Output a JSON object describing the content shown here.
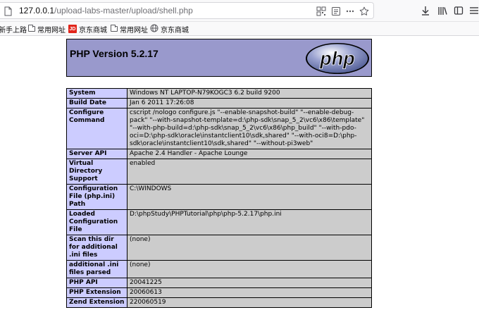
{
  "browser": {
    "url_host": "127.0.0.1",
    "url_path": "/upload-labs-master/upload/shell.php"
  },
  "bookmarks": [
    {
      "label": "新手上路",
      "icon": "none"
    },
    {
      "label": "常用网址",
      "icon": "folder-icon"
    },
    {
      "label": "京东商城",
      "icon": "jd-logo-icon"
    },
    {
      "label": "常用网址",
      "icon": "folder-icon"
    },
    {
      "label": "京东商城",
      "icon": "globe-icon"
    }
  ],
  "page": {
    "title": "PHP Version 5.2.17",
    "logo_text": "php",
    "rows": [
      {
        "key": "System",
        "value": "Windows NT LAPTOP-N79KOGC3 6.2 build 9200"
      },
      {
        "key": "Build Date",
        "value": "Jan 6 2011 17:26:08"
      },
      {
        "key": "Configure Command",
        "value": "cscript /nologo configure.js \"--enable-snapshot-build\" \"--enable-debug-pack\" \"--with-snapshot-template=d:\\php-sdk\\snap_5_2\\vc6\\x86\\template\" \"--with-php-build=d:\\php-sdk\\snap_5_2\\vc6\\x86\\php_build\" \"--with-pdo-oci=D:\\php-sdk\\oracle\\instantclient10\\sdk,shared\" \"--with-oci8=D:\\php-sdk\\oracle\\instantclient10\\sdk,shared\" \"--without-pi3web\""
      },
      {
        "key": "Server API",
        "value": "Apache 2.4 Handler - Apache Lounge"
      },
      {
        "key": "Virtual Directory Support",
        "value": "enabled"
      },
      {
        "key": "Configuration File (php.ini) Path",
        "value": "C:\\WINDOWS"
      },
      {
        "key": "Loaded Configuration File",
        "value": "D:\\phpStudy\\PHPTutorial\\php\\php-5.2.17\\php.ini"
      },
      {
        "key": "Scan this dir for additional .ini files",
        "value": "(none)"
      },
      {
        "key": "additional .ini files parsed",
        "value": "(none)"
      },
      {
        "key": "PHP API",
        "value": "20041225"
      },
      {
        "key": "PHP Extension",
        "value": "20060613"
      },
      {
        "key": "Zend Extension",
        "value": "220060519"
      }
    ]
  },
  "colors": {
    "header_bg": "#9999cc",
    "key_bg": "#ccccff",
    "value_bg": "#cccccc"
  }
}
